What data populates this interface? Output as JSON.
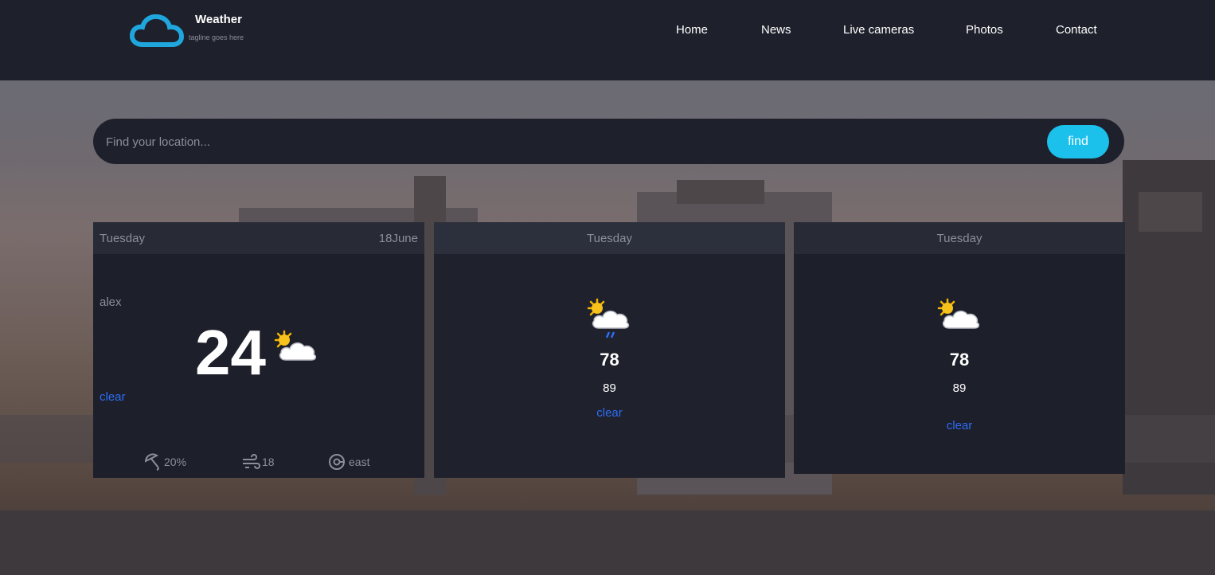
{
  "header": {
    "title": "Weather",
    "tagline": "tagline goes here",
    "nav": [
      "Home",
      "News",
      "Live cameras",
      "Photos",
      "Contact"
    ]
  },
  "search": {
    "placeholder": "Find your location...",
    "button": "find"
  },
  "today": {
    "day": "Tuesday",
    "date": "18June",
    "location": "alex",
    "temperature": "24",
    "condition": "clear",
    "icon": "sun-cloud-icon",
    "stats": {
      "rain": "20%",
      "wind": "18",
      "direction": "east"
    }
  },
  "forecast": [
    {
      "day": "Tuesday",
      "icon": "sun-cloud-rain-icon",
      "max": "78",
      "min": "89",
      "condition": "clear"
    },
    {
      "day": "Tuesday",
      "icon": "sun-cloud-icon",
      "max": "78",
      "min": "89",
      "condition": "clear"
    }
  ],
  "colors": {
    "accent": "#1bc0eb",
    "link": "#2d6df6",
    "header_bg": "#1e202b"
  }
}
